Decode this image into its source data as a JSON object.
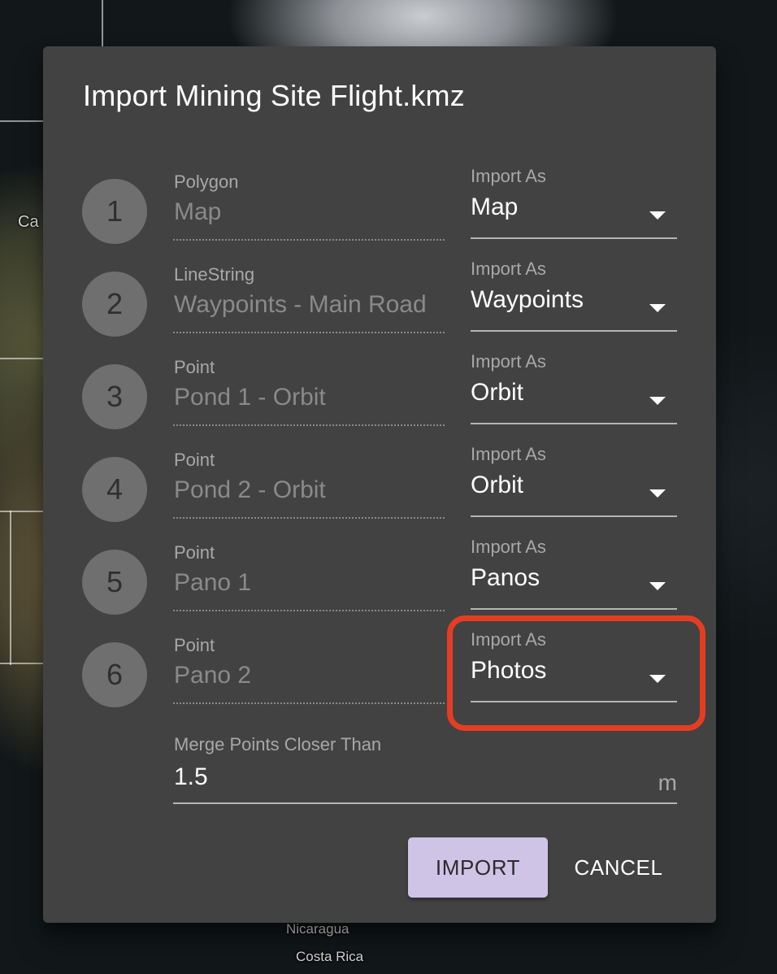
{
  "map": {
    "labels": {
      "left_edge": "Ca",
      "country_1": "Nicaragua",
      "country_2": "Costa Rica"
    }
  },
  "dialog": {
    "title": "Import Mining Site Flight.kmz",
    "import_as_label": "Import As",
    "rows": [
      {
        "step": "1",
        "geometry": "Polygon",
        "name": "Map",
        "import_as": "Map"
      },
      {
        "step": "2",
        "geometry": "LineString",
        "name": "Waypoints - Main Road",
        "import_as": "Waypoints"
      },
      {
        "step": "3",
        "geometry": "Point",
        "name": "Pond 1 - Orbit",
        "import_as": "Orbit"
      },
      {
        "step": "4",
        "geometry": "Point",
        "name": "Pond 2 - Orbit",
        "import_as": "Orbit"
      },
      {
        "step": "5",
        "geometry": "Point",
        "name": "Pano 1",
        "import_as": "Panos"
      },
      {
        "step": "6",
        "geometry": "Point",
        "name": "Pano 2",
        "import_as": "Photos"
      }
    ],
    "merge": {
      "label": "Merge Points Closer Than",
      "value": "1.5",
      "unit": "m"
    },
    "buttons": {
      "import": "IMPORT",
      "cancel": "CANCEL"
    },
    "highlight_color": "#e53d22",
    "accent_color": "#cfc4e6"
  }
}
